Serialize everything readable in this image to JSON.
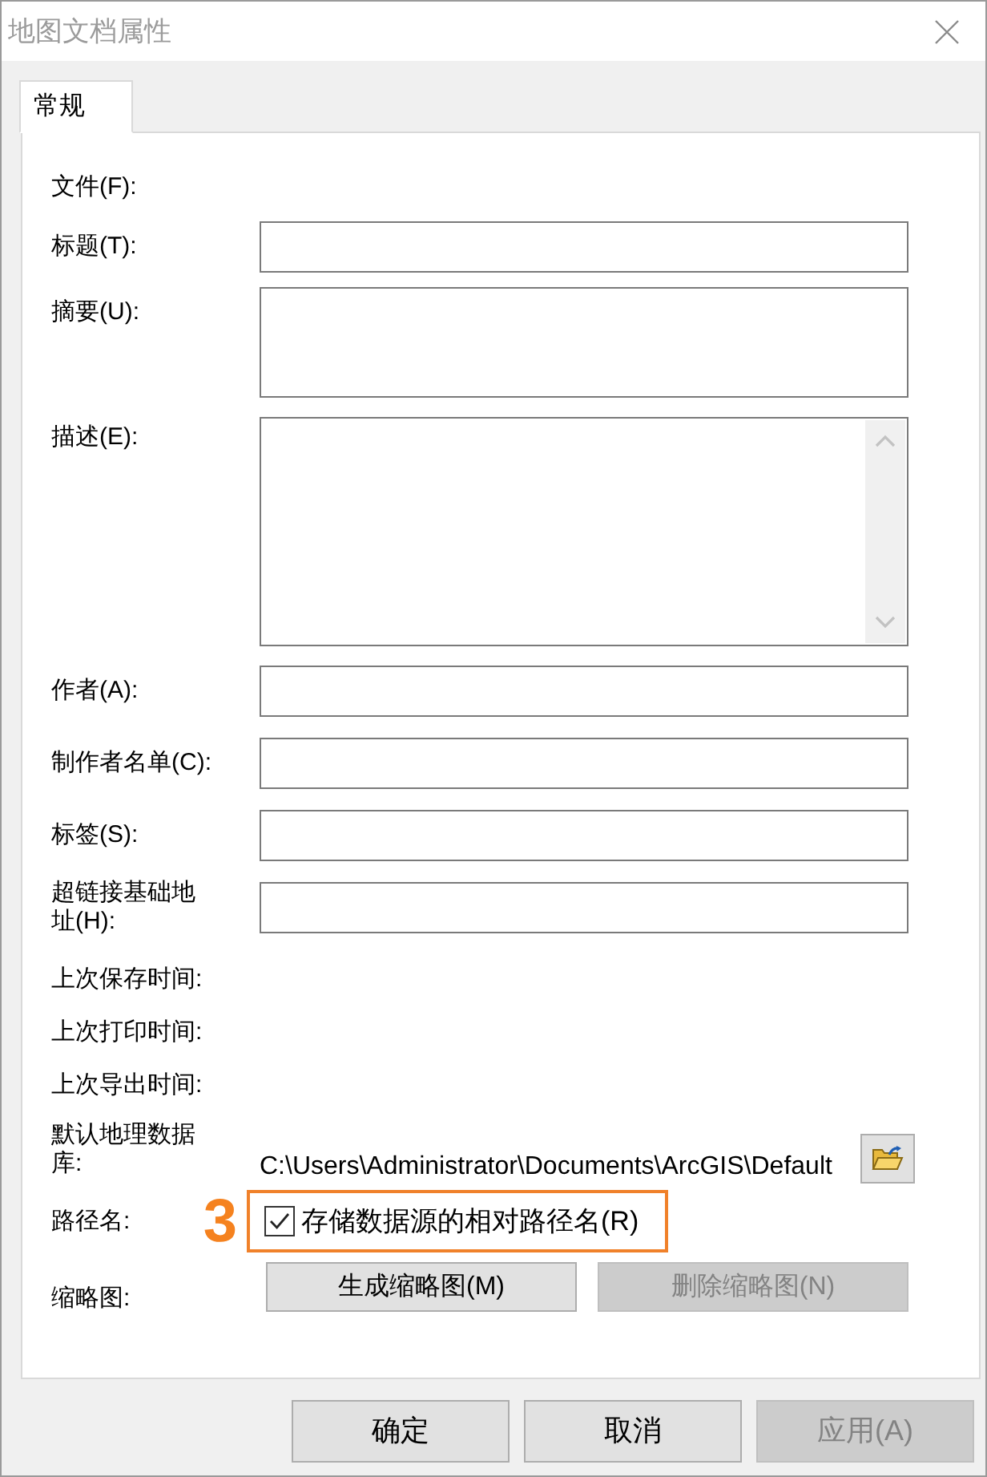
{
  "window": {
    "title": "地图文档属性"
  },
  "tabs": [
    {
      "label": "常规",
      "selected": true
    }
  ],
  "fields": [
    {
      "kind": "static",
      "label": "文件(F):"
    },
    {
      "kind": "text",
      "label": "标题(T):"
    },
    {
      "kind": "textarea",
      "label": "摘要(U):"
    },
    {
      "kind": "scroll_textarea",
      "label": "描述(E):"
    },
    {
      "kind": "text",
      "label": "作者(A):"
    },
    {
      "kind": "text",
      "label": "制作者名单(C):"
    },
    {
      "kind": "text",
      "label": "标签(S):"
    },
    {
      "kind": "text",
      "label": "超链接基础地址(H):"
    },
    {
      "kind": "static",
      "label": "上次保存时间:"
    },
    {
      "kind": "static",
      "label": "上次打印时间:"
    },
    {
      "kind": "static",
      "label": "上次导出时间:"
    },
    {
      "kind": "path",
      "label": "默认地理数据库:",
      "value": "C:\\Users\\Administrator\\Documents\\ArcGIS\\Default"
    },
    {
      "kind": "checkbox",
      "label": "路径名:",
      "option": "存储数据源的相对路径名(R)",
      "checked": true,
      "callout": "3"
    },
    {
      "kind": "buttons",
      "label": "缩略图:",
      "buttons": [
        {
          "label": "生成缩略图(M)",
          "disabled": false
        },
        {
          "label": "删除缩略图(N)",
          "disabled": true
        }
      ]
    }
  ],
  "buttons": [
    {
      "label": "确定",
      "disabled": false
    },
    {
      "label": "取消",
      "disabled": false
    },
    {
      "label": "应用(A)",
      "disabled": true
    }
  ]
}
